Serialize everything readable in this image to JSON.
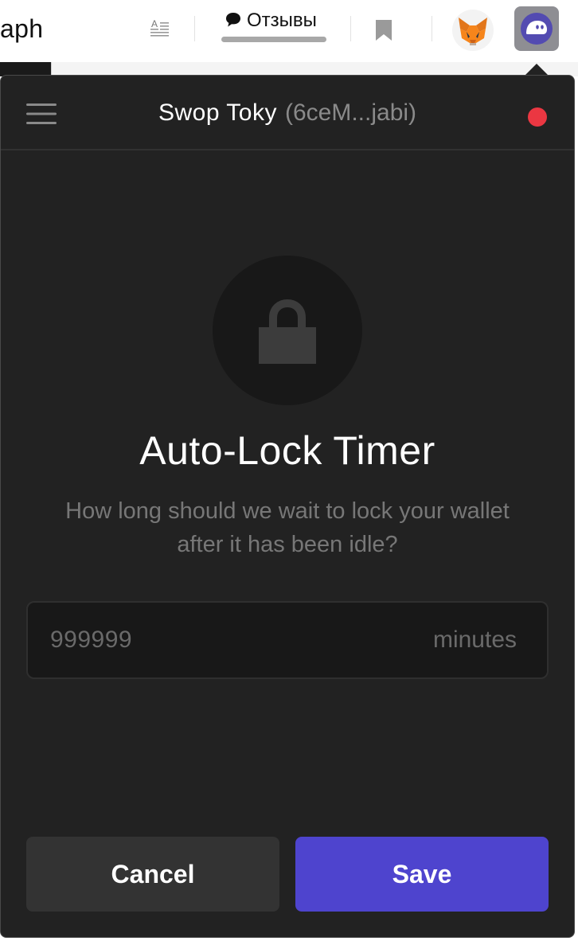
{
  "browser": {
    "url_fragment": "aph",
    "feedback_label": "Отзывы",
    "icons": {
      "reader": "reader-mode-icon",
      "feedback": "speech-bubble-icon",
      "bookmark": "bookmark-icon",
      "metamask": "metamask-fox-icon",
      "phantom": "phantom-ghost-icon"
    }
  },
  "popup": {
    "header": {
      "wallet_name": "Swop Toky",
      "wallet_address": "(6ceM...jabi)",
      "status_color": "#eb3742"
    },
    "title": "Auto-Lock Timer",
    "description": "How long should we wait to lock your wallet after it has been idle?",
    "timer_input": {
      "value": "",
      "placeholder": "999999",
      "suffix": "minutes"
    },
    "buttons": {
      "cancel": "Cancel",
      "save": "Save"
    }
  },
  "colors": {
    "popup_bg": "#222222",
    "accent": "#4e44ce",
    "cancel_bg": "#333333",
    "muted_text": "#777777"
  }
}
